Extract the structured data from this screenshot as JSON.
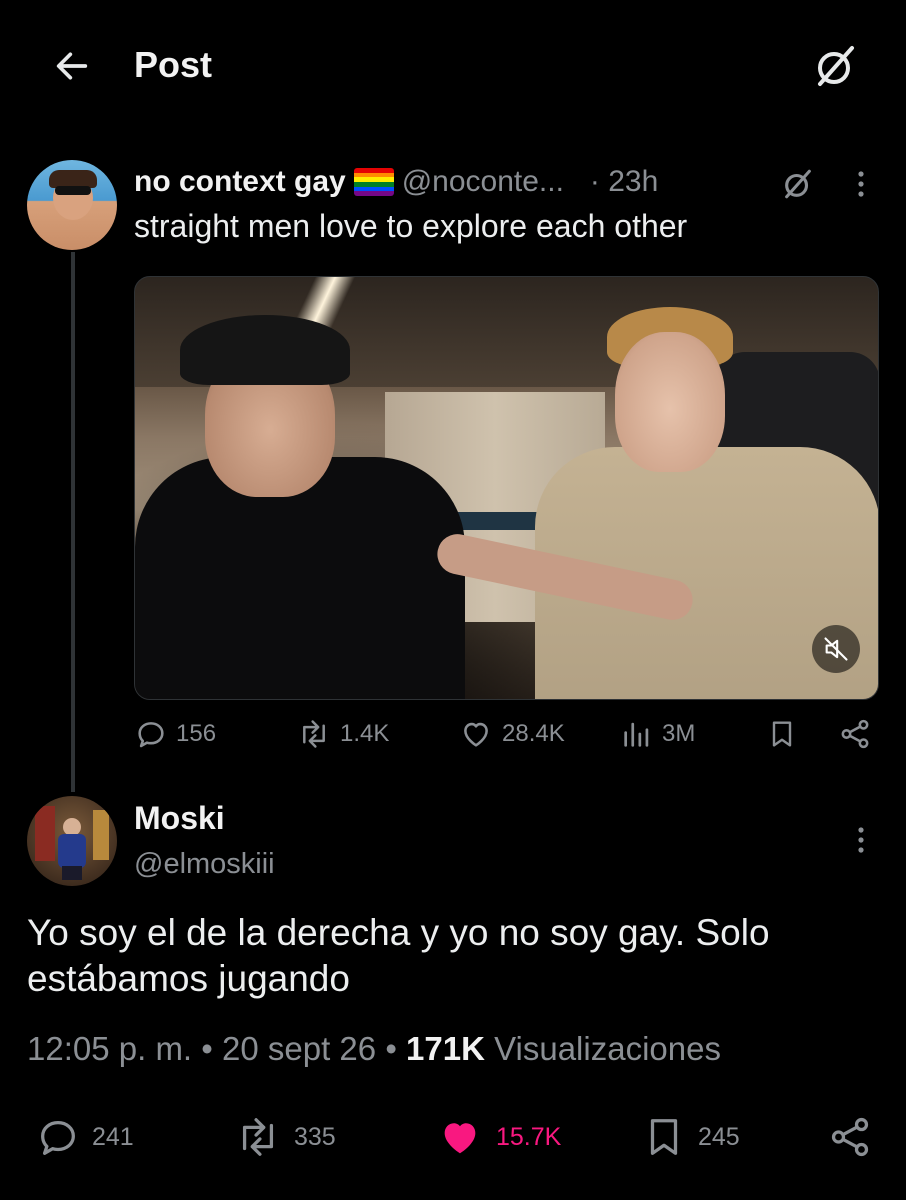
{
  "header": {
    "title": "Post"
  },
  "original_post": {
    "display_name": "no context gay",
    "handle": "@noconte...",
    "time": "· 23h",
    "text": "straight men love to explore each other",
    "stats": {
      "replies": "156",
      "reposts": "1.4K",
      "likes": "28.4K",
      "views": "3M"
    }
  },
  "reply_post": {
    "display_name": "Moski",
    "handle": "@elmoskiii",
    "text": "Yo soy el de la derecha y yo no soy gay. Solo estábamos jugando",
    "time": "12:05 p. m.",
    "date": "20 sept 26",
    "separator": "•",
    "views_count": "171K",
    "views_label": "Visualizaciones",
    "stats": {
      "replies": "241",
      "reposts": "335",
      "likes": "15.7K",
      "bookmarks": "245"
    },
    "liked": true
  },
  "colors": {
    "background": "#000000",
    "secondary_text": "#8b8f94",
    "like_pink": "#f91880"
  },
  "icons": [
    "back-arrow-icon",
    "grok-icon",
    "rainbow-flag-icon",
    "more-icon",
    "reply-icon",
    "repost-icon",
    "heart-icon",
    "views-icon",
    "bookmark-icon",
    "share-icon",
    "mute-icon"
  ]
}
